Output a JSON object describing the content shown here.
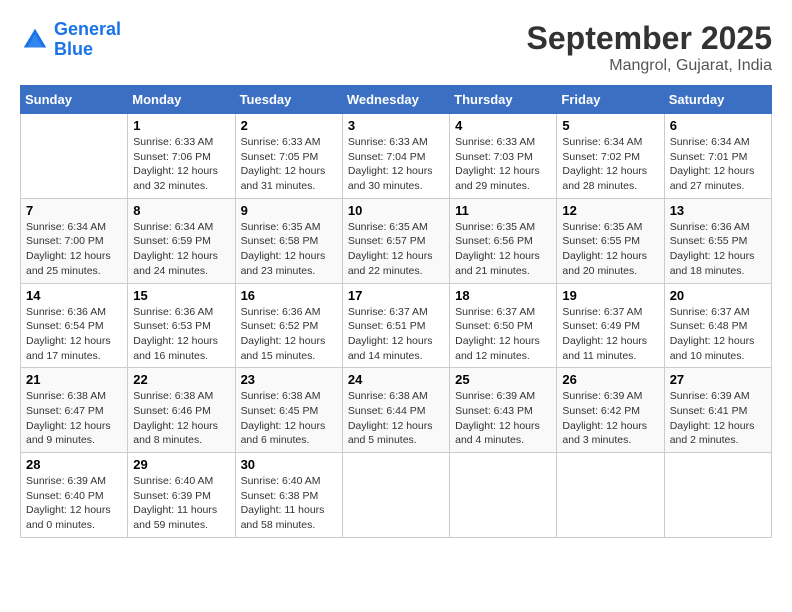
{
  "header": {
    "logo_line1": "General",
    "logo_line2": "Blue",
    "month": "September 2025",
    "location": "Mangrol, Gujarat, India"
  },
  "weekdays": [
    "Sunday",
    "Monday",
    "Tuesday",
    "Wednesday",
    "Thursday",
    "Friday",
    "Saturday"
  ],
  "weeks": [
    [
      {
        "day": "",
        "info": ""
      },
      {
        "day": "1",
        "info": "Sunrise: 6:33 AM\nSunset: 7:06 PM\nDaylight: 12 hours\nand 32 minutes."
      },
      {
        "day": "2",
        "info": "Sunrise: 6:33 AM\nSunset: 7:05 PM\nDaylight: 12 hours\nand 31 minutes."
      },
      {
        "day": "3",
        "info": "Sunrise: 6:33 AM\nSunset: 7:04 PM\nDaylight: 12 hours\nand 30 minutes."
      },
      {
        "day": "4",
        "info": "Sunrise: 6:33 AM\nSunset: 7:03 PM\nDaylight: 12 hours\nand 29 minutes."
      },
      {
        "day": "5",
        "info": "Sunrise: 6:34 AM\nSunset: 7:02 PM\nDaylight: 12 hours\nand 28 minutes."
      },
      {
        "day": "6",
        "info": "Sunrise: 6:34 AM\nSunset: 7:01 PM\nDaylight: 12 hours\nand 27 minutes."
      }
    ],
    [
      {
        "day": "7",
        "info": "Sunrise: 6:34 AM\nSunset: 7:00 PM\nDaylight: 12 hours\nand 25 minutes."
      },
      {
        "day": "8",
        "info": "Sunrise: 6:34 AM\nSunset: 6:59 PM\nDaylight: 12 hours\nand 24 minutes."
      },
      {
        "day": "9",
        "info": "Sunrise: 6:35 AM\nSunset: 6:58 PM\nDaylight: 12 hours\nand 23 minutes."
      },
      {
        "day": "10",
        "info": "Sunrise: 6:35 AM\nSunset: 6:57 PM\nDaylight: 12 hours\nand 22 minutes."
      },
      {
        "day": "11",
        "info": "Sunrise: 6:35 AM\nSunset: 6:56 PM\nDaylight: 12 hours\nand 21 minutes."
      },
      {
        "day": "12",
        "info": "Sunrise: 6:35 AM\nSunset: 6:55 PM\nDaylight: 12 hours\nand 20 minutes."
      },
      {
        "day": "13",
        "info": "Sunrise: 6:36 AM\nSunset: 6:55 PM\nDaylight: 12 hours\nand 18 minutes."
      }
    ],
    [
      {
        "day": "14",
        "info": "Sunrise: 6:36 AM\nSunset: 6:54 PM\nDaylight: 12 hours\nand 17 minutes."
      },
      {
        "day": "15",
        "info": "Sunrise: 6:36 AM\nSunset: 6:53 PM\nDaylight: 12 hours\nand 16 minutes."
      },
      {
        "day": "16",
        "info": "Sunrise: 6:36 AM\nSunset: 6:52 PM\nDaylight: 12 hours\nand 15 minutes."
      },
      {
        "day": "17",
        "info": "Sunrise: 6:37 AM\nSunset: 6:51 PM\nDaylight: 12 hours\nand 14 minutes."
      },
      {
        "day": "18",
        "info": "Sunrise: 6:37 AM\nSunset: 6:50 PM\nDaylight: 12 hours\nand 12 minutes."
      },
      {
        "day": "19",
        "info": "Sunrise: 6:37 AM\nSunset: 6:49 PM\nDaylight: 12 hours\nand 11 minutes."
      },
      {
        "day": "20",
        "info": "Sunrise: 6:37 AM\nSunset: 6:48 PM\nDaylight: 12 hours\nand 10 minutes."
      }
    ],
    [
      {
        "day": "21",
        "info": "Sunrise: 6:38 AM\nSunset: 6:47 PM\nDaylight: 12 hours\nand 9 minutes."
      },
      {
        "day": "22",
        "info": "Sunrise: 6:38 AM\nSunset: 6:46 PM\nDaylight: 12 hours\nand 8 minutes."
      },
      {
        "day": "23",
        "info": "Sunrise: 6:38 AM\nSunset: 6:45 PM\nDaylight: 12 hours\nand 6 minutes."
      },
      {
        "day": "24",
        "info": "Sunrise: 6:38 AM\nSunset: 6:44 PM\nDaylight: 12 hours\nand 5 minutes."
      },
      {
        "day": "25",
        "info": "Sunrise: 6:39 AM\nSunset: 6:43 PM\nDaylight: 12 hours\nand 4 minutes."
      },
      {
        "day": "26",
        "info": "Sunrise: 6:39 AM\nSunset: 6:42 PM\nDaylight: 12 hours\nand 3 minutes."
      },
      {
        "day": "27",
        "info": "Sunrise: 6:39 AM\nSunset: 6:41 PM\nDaylight: 12 hours\nand 2 minutes."
      }
    ],
    [
      {
        "day": "28",
        "info": "Sunrise: 6:39 AM\nSunset: 6:40 PM\nDaylight: 12 hours\nand 0 minutes."
      },
      {
        "day": "29",
        "info": "Sunrise: 6:40 AM\nSunset: 6:39 PM\nDaylight: 11 hours\nand 59 minutes."
      },
      {
        "day": "30",
        "info": "Sunrise: 6:40 AM\nSunset: 6:38 PM\nDaylight: 11 hours\nand 58 minutes."
      },
      {
        "day": "",
        "info": ""
      },
      {
        "day": "",
        "info": ""
      },
      {
        "day": "",
        "info": ""
      },
      {
        "day": "",
        "info": ""
      }
    ]
  ]
}
